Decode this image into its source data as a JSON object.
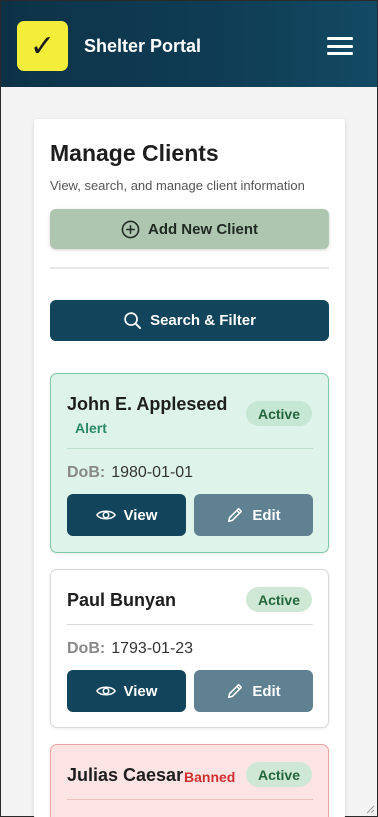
{
  "header": {
    "logo_glyph": "✓",
    "app_title": "Shelter Portal",
    "menu_icon": "hamburger-icon",
    "colors": {
      "header_bg": "#0f3d55",
      "logo_bg": "#f2ee3a"
    }
  },
  "page": {
    "title": "Manage Clients",
    "subtitle": "View, search, and manage client information",
    "add_button_label": "Add New Client",
    "search_button_label": "Search & Filter"
  },
  "clients": [
    {
      "name": "John E. Appleseed",
      "flag": "Alert",
      "status": "Active",
      "dob_label": "DoB:",
      "dob": "1980-01-01",
      "view_label": "View",
      "edit_label": "Edit"
    },
    {
      "name": "Paul Bunyan",
      "flag": "",
      "status": "Active",
      "dob_label": "DoB:",
      "dob": "1793-01-23",
      "view_label": "View",
      "edit_label": "Edit"
    },
    {
      "name": "Julias Caesar",
      "flag": "Banned",
      "status": "Active"
    }
  ],
  "colors": {
    "accent": "#12445c",
    "add_button": "#aec5b0",
    "edit_button": "#5f8191",
    "alert_card_bg": "#def4ea",
    "banned_card_bg": "#fde4e4",
    "active_badge_bg": "#cfe8d5"
  }
}
